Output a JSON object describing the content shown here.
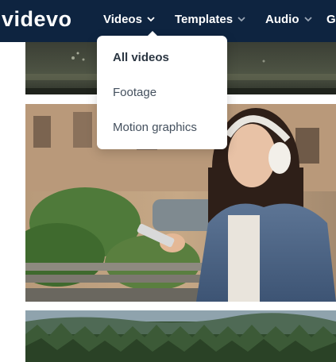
{
  "header": {
    "logo_text": "videvo",
    "nav": [
      {
        "label": "Videos",
        "icon": "chevron-down-icon"
      },
      {
        "label": "Templates",
        "icon": "chevron-down-icon"
      },
      {
        "label": "Audio",
        "icon": "chevron-down-icon"
      },
      {
        "label": "G"
      }
    ]
  },
  "dropdown": {
    "items": [
      {
        "label": "All videos",
        "active": true
      },
      {
        "label": "Footage",
        "active": false
      },
      {
        "label": "Motion graphics",
        "active": false
      }
    ]
  },
  "thumbnails": [
    {
      "description_icon": "wet-asphalt-clip-thumbnail"
    },
    {
      "description_icon": "woman-headphones-clip-thumbnail"
    },
    {
      "description_icon": "forest-clip-thumbnail"
    }
  ],
  "colors": {
    "nav_bg": "#0e2440",
    "dropdown_bg": "#ffffff",
    "dropdown_text": "#44505e"
  }
}
